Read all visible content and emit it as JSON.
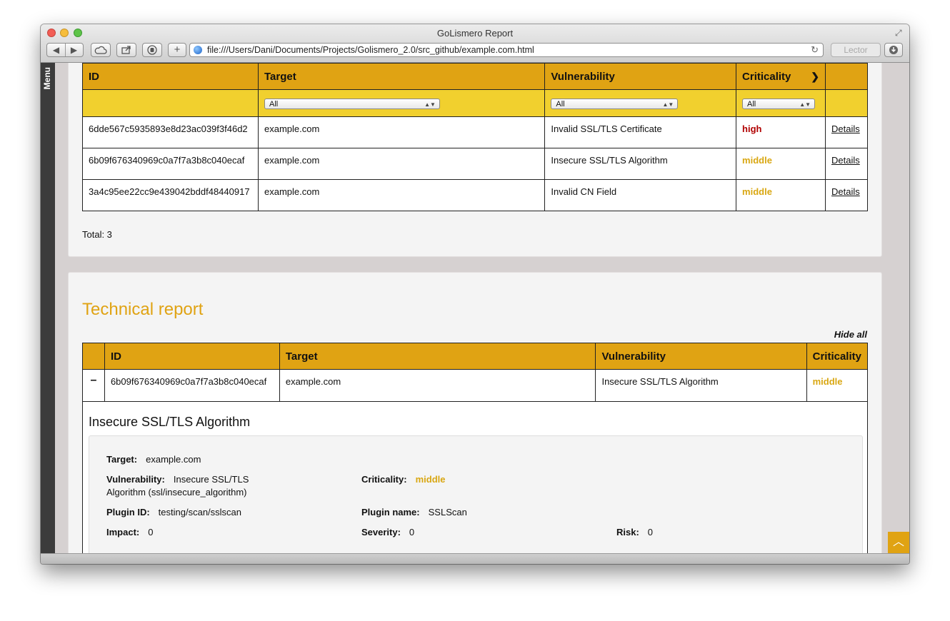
{
  "window": {
    "title": "GoLismero Report"
  },
  "toolbar": {
    "url": "file:///Users/Dani/Documents/Projects/Golismero_2.0/src_github/example.com.html",
    "reader_label": "Lector",
    "back_glyph": "◀",
    "forward_glyph": "▶",
    "add_glyph": "+"
  },
  "sidebar": {
    "menu_label": "Menu"
  },
  "vuln_table": {
    "headers": {
      "id": "ID",
      "target": "Target",
      "vulnerability": "Vulnerability",
      "criticality": "Criticality"
    },
    "filters": {
      "target": "All",
      "vulnerability": "All",
      "criticality": "All"
    },
    "rows": [
      {
        "id": "6dde567c5935893e8d23ac039f3f46d2",
        "target": "example.com",
        "vulnerability": "Invalid SSL/TLS Certificate",
        "criticality": "high",
        "details": "Details"
      },
      {
        "id": "6b09f676340969c0a7f7a3b8c040ecaf",
        "target": "example.com",
        "vulnerability": "Insecure SSL/TLS Algorithm",
        "criticality": "middle",
        "details": "Details"
      },
      {
        "id": "3a4c95ee22cc9e439042bddf48440917",
        "target": "example.com",
        "vulnerability": "Invalid CN Field",
        "criticality": "middle",
        "details": "Details"
      }
    ],
    "total": "Total: 3"
  },
  "technical_report": {
    "title": "Technical report",
    "hide_all": "Hide all",
    "headers": {
      "id": "ID",
      "target": "Target",
      "vulnerability": "Vulnerability",
      "criticality": "Criticality"
    },
    "row": {
      "toggle": "–",
      "id": "6b09f676340969c0a7f7a3b8c040ecaf",
      "target": "example.com",
      "vulnerability": "Insecure SSL/TLS Algorithm",
      "criticality": "middle"
    },
    "detail": {
      "title": "Insecure SSL/TLS Algorithm",
      "target_label": "Target:",
      "target_value": "example.com",
      "vulnerability_label": "Vulnerability:",
      "vulnerability_value": "Insecure SSL/TLS Algorithm (ssl/insecure_algorithm)",
      "criticality_label": "Criticality:",
      "criticality_value": "middle",
      "plugin_id_label": "Plugin ID:",
      "plugin_id_value": "testing/scan/sslscan",
      "plugin_name_label": "Plugin name:",
      "plugin_name_value": "SSLScan",
      "impact_label": "Impact:",
      "impact_value": "0",
      "severity_label": "Severity:",
      "severity_value": "0",
      "risk_label": "Risk:",
      "risk_value": "0"
    }
  },
  "colors": {
    "accent": "#e0a313",
    "filter_row": "#f1d02e",
    "high": "#b00000",
    "middle": "#d9a712"
  }
}
